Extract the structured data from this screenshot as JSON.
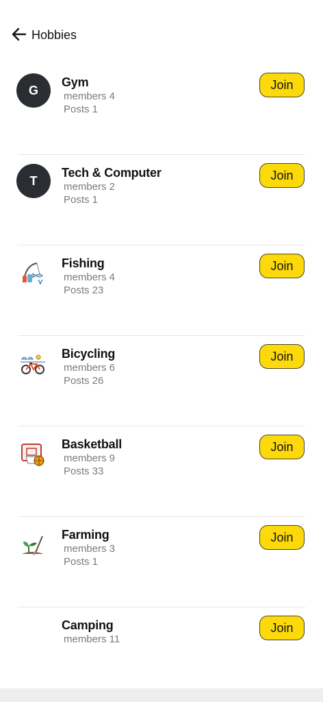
{
  "header": {
    "title": "Hobbies"
  },
  "hobbies": [
    {
      "name": "Gym",
      "members": "members 4",
      "posts": "Posts 1",
      "avatar_letter": "G",
      "icon": "letter-avatar",
      "join": "Join"
    },
    {
      "name": "Tech & Computer",
      "members": "members 2",
      "posts": "Posts 1",
      "avatar_letter": "T",
      "icon": "letter-avatar",
      "join": "Join"
    },
    {
      "name": "Fishing",
      "members": "members 4",
      "posts": "Posts 23",
      "icon": "fishing-icon",
      "join": "Join"
    },
    {
      "name": "Bicycling",
      "members": "members 6",
      "posts": "Posts 26",
      "icon": "bicycle-icon",
      "join": "Join"
    },
    {
      "name": "Basketball",
      "members": "members 9",
      "posts": "Posts 33",
      "icon": "basketball-hoop-icon",
      "join": "Join"
    },
    {
      "name": "Farming",
      "members": "members 3",
      "posts": "Posts 1",
      "icon": "farming-icon",
      "join": "Join"
    },
    {
      "name": "Camping",
      "members": "members 11",
      "posts": "",
      "icon": "",
      "join": "Join"
    }
  ],
  "colors": {
    "join_bg": "#fbd90a",
    "avatar_bg": "#2a2d31"
  }
}
